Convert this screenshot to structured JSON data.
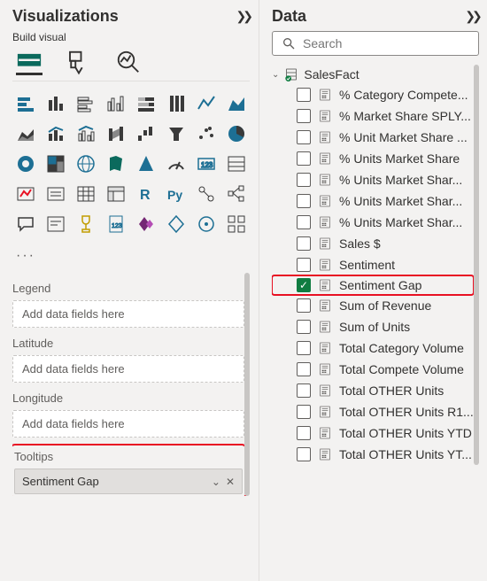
{
  "viz": {
    "title": "Visualizations",
    "subtitle": "Build visual",
    "more_label": "...",
    "wells": {
      "legend": {
        "label": "Legend",
        "placeholder": "Add data fields here"
      },
      "latitude": {
        "label": "Latitude",
        "placeholder": "Add data fields here"
      },
      "longitude": {
        "label": "Longitude",
        "placeholder": "Add data fields here"
      },
      "tooltips": {
        "label": "Tooltips",
        "field": "Sentiment Gap"
      }
    }
  },
  "data": {
    "title": "Data",
    "search_placeholder": "Search",
    "table": "SalesFact",
    "fields": [
      {
        "label": "% Category Compete...",
        "checked": false
      },
      {
        "label": "% Market Share SPLY...",
        "checked": false
      },
      {
        "label": "% Unit Market Share ...",
        "checked": false
      },
      {
        "label": "% Units Market Share",
        "checked": false
      },
      {
        "label": "% Units Market Shar...",
        "checked": false
      },
      {
        "label": "% Units Market Shar...",
        "checked": false
      },
      {
        "label": "% Units Market Shar...",
        "checked": false
      },
      {
        "label": "Sales $",
        "checked": false
      },
      {
        "label": "Sentiment",
        "checked": false
      },
      {
        "label": "Sentiment Gap",
        "checked": true,
        "highlight": true
      },
      {
        "label": "Sum of Revenue",
        "checked": false
      },
      {
        "label": "Sum of Units",
        "checked": false
      },
      {
        "label": "Total Category Volume",
        "checked": false
      },
      {
        "label": "Total Compete Volume",
        "checked": false
      },
      {
        "label": "Total OTHER Units",
        "checked": false
      },
      {
        "label": "Total OTHER Units R1...",
        "checked": false
      },
      {
        "label": "Total OTHER Units YTD",
        "checked": false
      },
      {
        "label": "Total OTHER Units YT...",
        "checked": false
      }
    ]
  }
}
